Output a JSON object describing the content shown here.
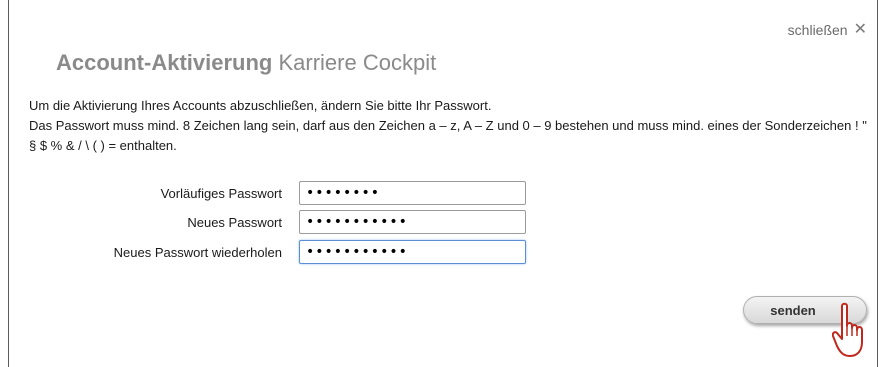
{
  "dialog": {
    "close_label": "schließen",
    "close_icon": "close-icon",
    "title_strong": "Account-Aktivierung",
    "title_rest": "Karriere Cockpit",
    "intro_line1": "Um die Aktivierung Ihres Accounts abzuschließen, ändern Sie bitte Ihr Passwort.",
    "intro_line2": "Das Passwort muss mind. 8 Zeichen lang sein, darf aus den Zeichen a – z, A – Z und 0 – 9 bestehen und muss mind. eines der Sonderzeichen ! \" § $ % & / \\ ( ) = enthalten."
  },
  "form": {
    "fields": [
      {
        "label": "Vorläufiges Passwort",
        "value": "••••••••"
      },
      {
        "label": "Neues Passwort",
        "value": "•••••••••••"
      },
      {
        "label": "Neues Passwort wiederholen",
        "value": "•••••••••••"
      }
    ],
    "submit_label": "senden"
  },
  "colors": {
    "title": "#8a8a8a",
    "border": "#5c5c5c",
    "focus": "#5a8fd6"
  }
}
